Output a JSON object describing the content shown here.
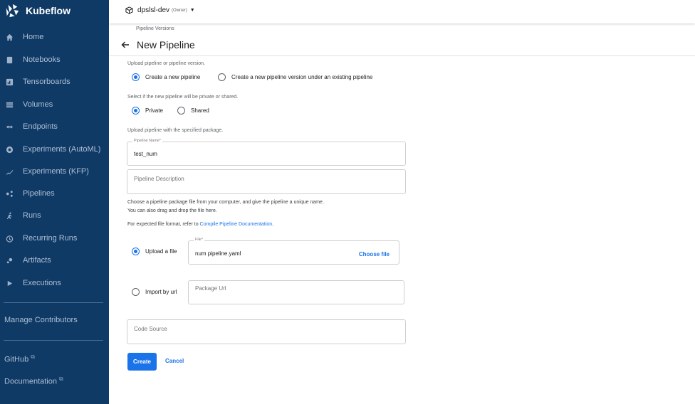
{
  "sidebar": {
    "brand": "Kubeflow",
    "items": [
      {
        "label": "Home",
        "icon": "home-icon"
      },
      {
        "label": "Notebooks",
        "icon": "notebook-icon"
      },
      {
        "label": "Tensorboards",
        "icon": "tensorboard-icon"
      },
      {
        "label": "Volumes",
        "icon": "volumes-icon"
      },
      {
        "label": "Endpoints",
        "icon": "endpoints-icon"
      },
      {
        "label": "Experiments (AutoML)",
        "icon": "automl-icon"
      },
      {
        "label": "Experiments (KFP)",
        "icon": "kfp-icon"
      },
      {
        "label": "Pipelines",
        "icon": "pipelines-icon"
      },
      {
        "label": "Runs",
        "icon": "runs-icon"
      },
      {
        "label": "Recurring Runs",
        "icon": "recurring-runs-icon"
      },
      {
        "label": "Artifacts",
        "icon": "artifacts-icon"
      },
      {
        "label": "Executions",
        "icon": "executions-icon"
      }
    ],
    "manage_contributors": "Manage Contributors",
    "github": "GitHub",
    "documentation": "Documentation"
  },
  "topbar": {
    "namespace": "dpslsl-dev",
    "role": "(Owner)"
  },
  "page": {
    "breadcrumb": "Pipeline Versions",
    "title": "New Pipeline",
    "upload_prompt": "Upload pipeline or pipeline version.",
    "option_new_pipeline": "Create a new pipeline",
    "option_new_version": "Create a new pipeline version under an existing pipeline",
    "visibility_prompt": "Select if the new pipeline will be private or shared.",
    "option_private": "Private",
    "option_shared": "Shared",
    "package_prompt": "Upload pipeline with the specified package.",
    "pipeline_name_label": "Pipeline Name*",
    "pipeline_name_value": "test_num",
    "pipeline_description_placeholder": "Pipeline Description",
    "help_line1": "Choose a pipeline package file from your computer, and give the pipeline a unique name.",
    "help_line2": "You can also drag and drop the file here.",
    "format_prefix": "For expected file format, refer to ",
    "format_link": "Compile Pipeline Documentation",
    "format_suffix": ".",
    "option_upload_file": "Upload a file",
    "file_label": "File*",
    "file_value": "num pipeline.yaml",
    "choose_file": "Choose file",
    "option_import_url": "Import by url",
    "package_url_placeholder": "Package Url",
    "code_source_placeholder": "Code Source",
    "create": "Create",
    "cancel": "Cancel"
  },
  "colors": {
    "sidebar_bg": "#0f3a66",
    "accent": "#1a73e8"
  }
}
